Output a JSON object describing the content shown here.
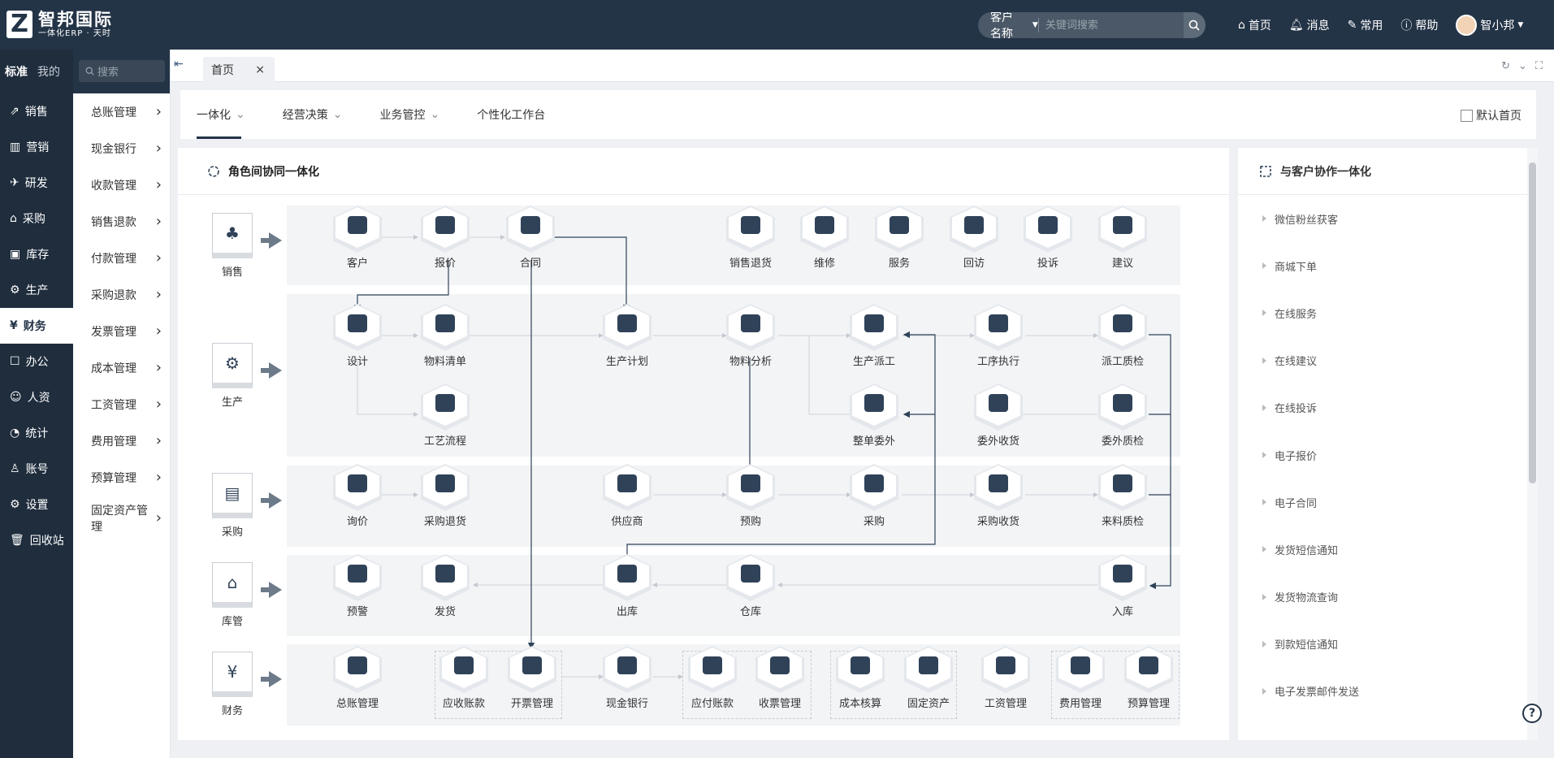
{
  "app": {
    "logo_name": "智邦国际",
    "logo_sub": "一体化ERP · 天时"
  },
  "search": {
    "type": "客户名称",
    "placeholder": "关键词搜索"
  },
  "topnav": {
    "home": "首页",
    "msg": "消息",
    "common": "常用",
    "help": "帮助",
    "user": "智小邦"
  },
  "sidebar": {
    "tab_std": "标准",
    "tab_mine": "我的",
    "search_placeholder": "搜索",
    "modules": [
      "销售",
      "营销",
      "研发",
      "采购",
      "库存",
      "生产",
      "财务",
      "办公",
      "人资",
      "统计",
      "账号",
      "设置",
      "回收站"
    ],
    "active": "财务"
  },
  "submenu": [
    "总账管理",
    "现金银行",
    "收款管理",
    "销售退款",
    "付款管理",
    "采购退款",
    "发票管理",
    "成本管理",
    "工资管理",
    "费用管理",
    "预算管理",
    "固定资产管理"
  ],
  "tabbar": {
    "tab": "首页"
  },
  "content_tabs": [
    "一体化",
    "经营决策",
    "业务管控",
    "个性化工作台"
  ],
  "default_home": "默认首页",
  "main_panel": {
    "title": "角色间协同一体化"
  },
  "roles": [
    "销售",
    "生产",
    "采购",
    "库管",
    "财务"
  ],
  "nodes": {
    "kehu": "客户",
    "baojia": "报价",
    "hetong": "合同",
    "xstk": "销售退货",
    "weixiu": "维修",
    "fuwu": "服务",
    "huifang": "回访",
    "tousu": "投诉",
    "jianyi": "建议",
    "sheji": "设计",
    "wlqd": "物料清单",
    "scjh": "生产计划",
    "wlfx": "物料分析",
    "scpg": "生产派工",
    "gxzx": "工序执行",
    "pgzj": "派工质检",
    "gylc": "工艺流程",
    "zdww": "整单委外",
    "wwsh": "委外收货",
    "wwzj": "委外质检",
    "xunjia": "询价",
    "cgtk": "采购退货",
    "gys": "供应商",
    "yugou": "预购",
    "caigou": "采购",
    "cgsh": "采购收货",
    "llzj": "来料质检",
    "yujing": "预警",
    "fahuo": "发货",
    "chuku": "出库",
    "cangku": "仓库",
    "ruku": "入库",
    "zzgl": "总账管理",
    "yszk": "应收账款",
    "kpgl": "开票管理",
    "xjyh": "现金银行",
    "yfzk": "应付账款",
    "spgl": "收票管理",
    "cbhs": "成本核算",
    "gdzc": "固定资产",
    "gzgl": "工资管理",
    "fygl": "费用管理",
    "ysgl": "预算管理"
  },
  "right_panel": {
    "title": "与客户协作一体化",
    "items": [
      "微信粉丝获客",
      "商城下单",
      "在线服务",
      "在线建议",
      "在线投诉",
      "电子报价",
      "电子合同",
      "发货短信通知",
      "发货物流查询",
      "到款短信通知",
      "电子发票邮件发送"
    ]
  },
  "colors": {
    "dark": "#243447",
    "accent": "#2f4258"
  }
}
